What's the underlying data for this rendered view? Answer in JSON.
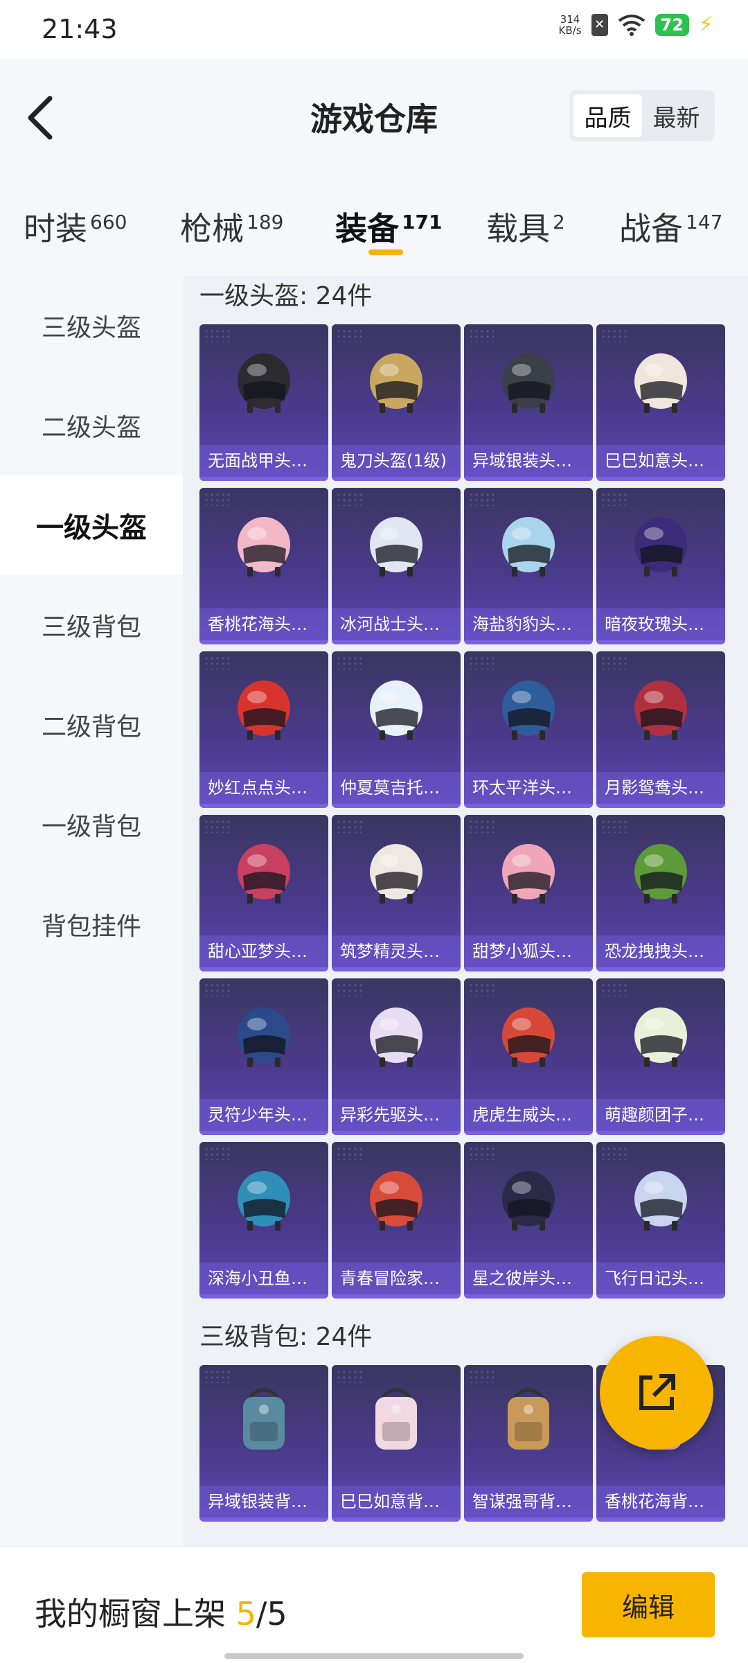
{
  "status_bar": {
    "time": "21:43",
    "net_speed_value": "314",
    "net_speed_unit": "KB/s",
    "battery": "72"
  },
  "header": {
    "title": "游戏仓库",
    "sort_options": [
      "品质",
      "最新"
    ],
    "active_sort": "品质"
  },
  "tabs": [
    {
      "label": "时装",
      "count": "660"
    },
    {
      "label": "枪械",
      "count": "189"
    },
    {
      "label": "装备",
      "count": "171"
    },
    {
      "label": "载具",
      "count": "2"
    },
    {
      "label": "战备",
      "count": "147"
    }
  ],
  "active_tab": "装备",
  "sidebar": {
    "items": [
      {
        "label": "三级头盔"
      },
      {
        "label": "二级头盔"
      },
      {
        "label": "一级头盔"
      },
      {
        "label": "三级背包"
      },
      {
        "label": "二级背包"
      },
      {
        "label": "一级背包"
      },
      {
        "label": "背包挂件"
      }
    ],
    "active": "一级头盔"
  },
  "sections": [
    {
      "title": "一级头盔: 24件",
      "items": [
        {
          "label": "无面战甲头…",
          "color": "#2b2b30",
          "icon": "helmet-icon"
        },
        {
          "label": "鬼刀头盔(1级)",
          "color": "#c8a860",
          "icon": "helmet-icon"
        },
        {
          "label": "异域银装头…",
          "color": "#3a3f48",
          "icon": "helmet-icon"
        },
        {
          "label": "巳巳如意头…",
          "color": "#f0e6dc",
          "icon": "helmet-icon"
        },
        {
          "label": "香桃花海头…",
          "color": "#f3b8c8",
          "icon": "helmet-icon"
        },
        {
          "label": "冰河战士头…",
          "color": "#dfe6f2",
          "icon": "helmet-icon"
        },
        {
          "label": "海盐豹豹头…",
          "color": "#a9d4ec",
          "icon": "helmet-icon"
        },
        {
          "label": "暗夜玫瑰头…",
          "color": "#3b2d7a",
          "icon": "helmet-icon"
        },
        {
          "label": "妙红点点头…",
          "color": "#d8342e",
          "icon": "helmet-icon"
        },
        {
          "label": "仲夏莫吉托…",
          "color": "#e6f2f8",
          "icon": "helmet-icon"
        },
        {
          "label": "环太平洋头…",
          "color": "#2f5c9a",
          "icon": "helmet-icon"
        },
        {
          "label": "月影鸳鸯头…",
          "color": "#b03040",
          "icon": "helmet-icon"
        },
        {
          "label": "甜心亚梦头…",
          "color": "#c84060",
          "icon": "helmet-icon"
        },
        {
          "label": "筑梦精灵头…",
          "color": "#efe8e0",
          "icon": "helmet-icon"
        },
        {
          "label": "甜梦小狐头…",
          "color": "#f0a6b8",
          "icon": "helmet-icon"
        },
        {
          "label": "恐龙拽拽头…",
          "color": "#5c9a3a",
          "icon": "helmet-icon"
        },
        {
          "label": "灵符少年头…",
          "color": "#2a4a8a",
          "icon": "helmet-icon"
        },
        {
          "label": "异彩先驱头…",
          "color": "#e8dcf0",
          "icon": "helmet-icon"
        },
        {
          "label": "虎虎生威头…",
          "color": "#d84838",
          "icon": "helmet-icon"
        },
        {
          "label": "萌趣颜团子…",
          "color": "#e8f0d8",
          "icon": "helmet-icon"
        },
        {
          "label": "深海小丑鱼…",
          "color": "#2f8fb8",
          "icon": "helmet-icon"
        },
        {
          "label": "青春冒险家…",
          "color": "#d84a3a",
          "icon": "helmet-icon"
        },
        {
          "label": "星之彼岸头…",
          "color": "#2a2a48",
          "icon": "helmet-icon"
        },
        {
          "label": "飞行日记头…",
          "color": "#c8d4f0",
          "icon": "helmet-icon"
        }
      ]
    },
    {
      "title": "三级背包: 24件",
      "items": [
        {
          "label": "异域银装背…",
          "color": "#5a8aa0",
          "icon": "backpack-icon"
        },
        {
          "label": "巳巳如意背…",
          "color": "#f2d8e0",
          "icon": "backpack-icon"
        },
        {
          "label": "智谋强哥背…",
          "color": "#c89a5a",
          "icon": "backpack-icon"
        },
        {
          "label": "香桃花海背…",
          "color": "#f3b8c8",
          "icon": "backpack-icon"
        }
      ]
    }
  ],
  "bottom_bar": {
    "showcase_label": "我的橱窗上架 ",
    "showcase_current": "5",
    "showcase_total": "/5",
    "edit_label": "编辑"
  }
}
